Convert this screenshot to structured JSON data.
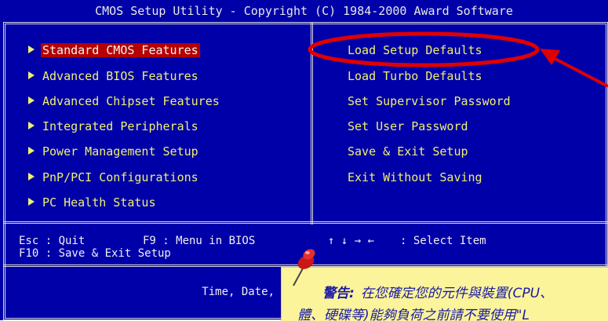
{
  "window_title": "CMOS Setup Utility - Copyright (C) 1984-2000 Award Software",
  "left_menu": [
    {
      "label": "Standard CMOS Features",
      "selected": true
    },
    {
      "label": "Advanced BIOS Features"
    },
    {
      "label": "Advanced Chipset Features"
    },
    {
      "label": "Integrated Peripherals"
    },
    {
      "label": "Power Management Setup"
    },
    {
      "label": "PnP/PCI Configurations"
    },
    {
      "label": "PC Health Status"
    }
  ],
  "right_menu": [
    {
      "label": "Load Setup Defaults",
      "circled": true
    },
    {
      "label": "Load Turbo Defaults"
    },
    {
      "label": "Set Supervisor Password"
    },
    {
      "label": "Set User Password"
    },
    {
      "label": "Save & Exit Setup"
    },
    {
      "label": "Exit Without Saving"
    }
  ],
  "help": {
    "esc": "Esc : Quit",
    "f9": "F9 : Menu in BIOS",
    "f10": "F10 : Save & Exit Setup",
    "arrows": "↑ ↓ → ←",
    "select": ": Select Item"
  },
  "status_text": "Time, Date,",
  "note": {
    "title": "警告:",
    "line1": "在您確定您的元件與裝置(CPU、",
    "line2": "體、硬碟等)能夠負荷之前請不要使用\"L"
  },
  "colors": {
    "background": "#0000a8",
    "menu_text": "#f0f070",
    "highlight": "#b40000",
    "annotation": "#e00000",
    "sticky_note": "#fbf49a"
  },
  "icons": {
    "pointer_arrow": "red-arrow-icon",
    "pushpin": "pushpin-icon",
    "menu_marker": "triangle-right-icon"
  }
}
